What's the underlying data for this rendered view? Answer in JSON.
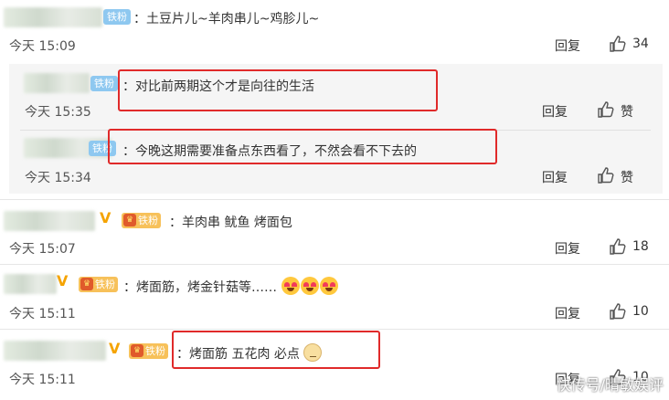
{
  "badge_tiefen": "铁粉",
  "reply_label": "回复",
  "like_label_zero": "赞",
  "comments": [
    {
      "text": "：土豆片儿~羊肉串儿~鸡胗儿~",
      "time": "今天 15:09",
      "likes": "34"
    },
    {
      "text": "：对比前两期这个才是向往的生活",
      "time": "今天 15:35",
      "likes": ""
    },
    {
      "text": "：今晚这期需要准备点东西看了，不然会看不下去的",
      "time": "今天 15:34",
      "likes": ""
    },
    {
      "text": "：羊肉串 鱿鱼 烤面包",
      "time": "今天 15:07",
      "likes": "18"
    },
    {
      "text": "：烤面筋，烤金针菇等……",
      "time": "今天 15:11",
      "likes": "10"
    },
    {
      "text": "：烤面筋 五花肉 必点",
      "time": "今天 15:11",
      "likes": "10"
    }
  ],
  "watermark": "快传号/晴敏娱评",
  "colors": {
    "highlight_box": "#e02a2a",
    "badge_blue": "#8ec8f0",
    "badge_gold": "#f7c15a"
  }
}
